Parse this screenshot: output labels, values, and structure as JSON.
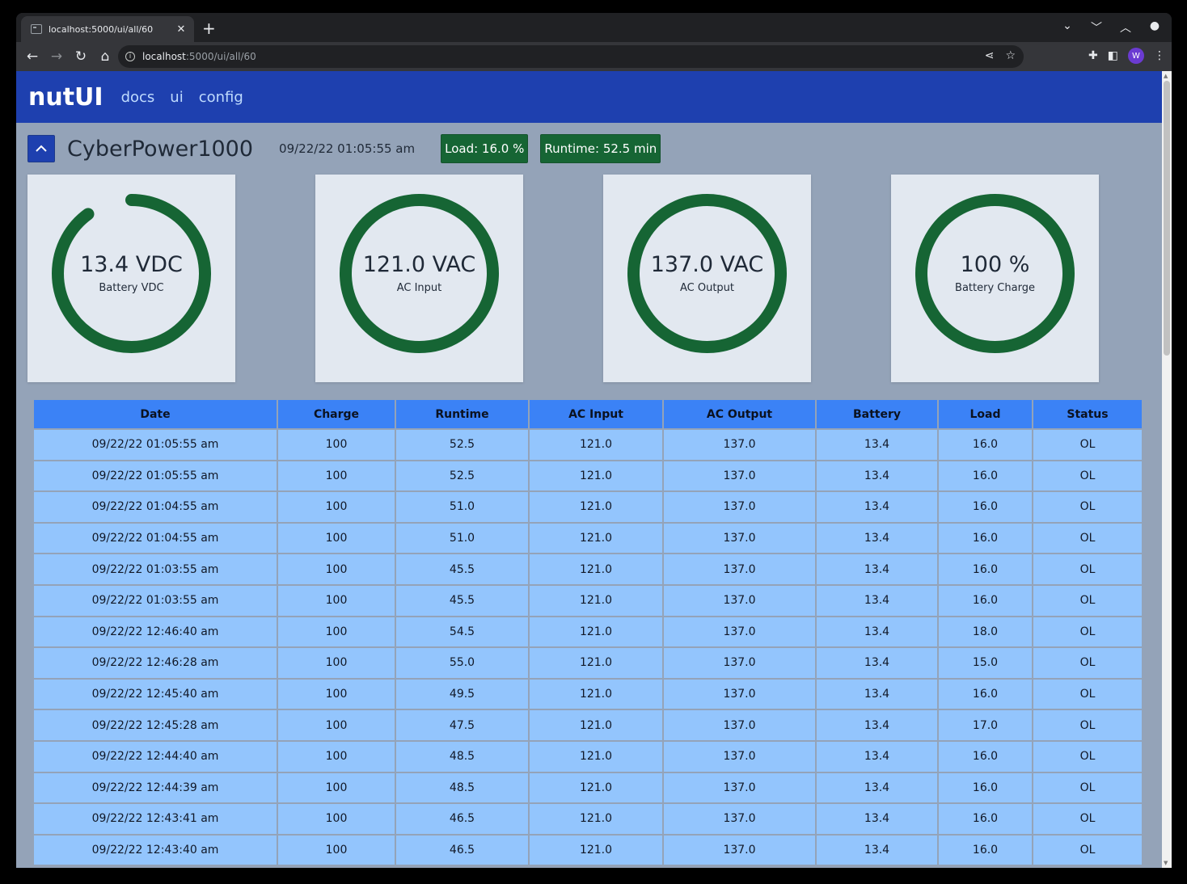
{
  "browser": {
    "tab_title": "localhost:5000/ui/all/60",
    "url_host": "localhost",
    "url_rest": ":5000/ui/all/60",
    "avatar_initial": "W"
  },
  "nav": {
    "brand": "nutUI",
    "links": [
      "docs",
      "ui",
      "config"
    ]
  },
  "device": {
    "name": "CyberPower1000",
    "timestamp": "09/22/22 01:05:55 am",
    "load_badge": "Load: 16.0 %",
    "runtime_badge": "Runtime: 52.5 min"
  },
  "gauges": [
    {
      "value_text": "13.4 VDC",
      "label": "Battery VDC",
      "fraction": 0.9
    },
    {
      "value_text": "121.0 VAC",
      "label": "AC Input",
      "fraction": 1.0
    },
    {
      "value_text": "137.0 VAC",
      "label": "AC Output",
      "fraction": 1.0
    },
    {
      "value_text": "100 %",
      "label": "Battery Charge",
      "fraction": 1.0
    }
  ],
  "colors": {
    "navbar": "#1e40af",
    "badge": "#166534",
    "gauge_ring": "#166534",
    "table_header": "#3b82f6",
    "table_cell": "#93c5fd",
    "page_bg": "#94a3b8",
    "card_bg": "#e2e8f0"
  },
  "table": {
    "columns": [
      "Date",
      "Charge",
      "Runtime",
      "AC Input",
      "AC Output",
      "Battery",
      "Load",
      "Status"
    ],
    "rows": [
      [
        "09/22/22 01:05:55 am",
        "100",
        "52.5",
        "121.0",
        "137.0",
        "13.4",
        "16.0",
        "OL"
      ],
      [
        "09/22/22 01:05:55 am",
        "100",
        "52.5",
        "121.0",
        "137.0",
        "13.4",
        "16.0",
        "OL"
      ],
      [
        "09/22/22 01:04:55 am",
        "100",
        "51.0",
        "121.0",
        "137.0",
        "13.4",
        "16.0",
        "OL"
      ],
      [
        "09/22/22 01:04:55 am",
        "100",
        "51.0",
        "121.0",
        "137.0",
        "13.4",
        "16.0",
        "OL"
      ],
      [
        "09/22/22 01:03:55 am",
        "100",
        "45.5",
        "121.0",
        "137.0",
        "13.4",
        "16.0",
        "OL"
      ],
      [
        "09/22/22 01:03:55 am",
        "100",
        "45.5",
        "121.0",
        "137.0",
        "13.4",
        "16.0",
        "OL"
      ],
      [
        "09/22/22 12:46:40 am",
        "100",
        "54.5",
        "121.0",
        "137.0",
        "13.4",
        "18.0",
        "OL"
      ],
      [
        "09/22/22 12:46:28 am",
        "100",
        "55.0",
        "121.0",
        "137.0",
        "13.4",
        "15.0",
        "OL"
      ],
      [
        "09/22/22 12:45:40 am",
        "100",
        "49.5",
        "121.0",
        "137.0",
        "13.4",
        "16.0",
        "OL"
      ],
      [
        "09/22/22 12:45:28 am",
        "100",
        "47.5",
        "121.0",
        "137.0",
        "13.4",
        "17.0",
        "OL"
      ],
      [
        "09/22/22 12:44:40 am",
        "100",
        "48.5",
        "121.0",
        "137.0",
        "13.4",
        "16.0",
        "OL"
      ],
      [
        "09/22/22 12:44:39 am",
        "100",
        "48.5",
        "121.0",
        "137.0",
        "13.4",
        "16.0",
        "OL"
      ],
      [
        "09/22/22 12:43:41 am",
        "100",
        "46.5",
        "121.0",
        "137.0",
        "13.4",
        "16.0",
        "OL"
      ],
      [
        "09/22/22 12:43:40 am",
        "100",
        "46.5",
        "121.0",
        "137.0",
        "13.4",
        "16.0",
        "OL"
      ]
    ]
  }
}
